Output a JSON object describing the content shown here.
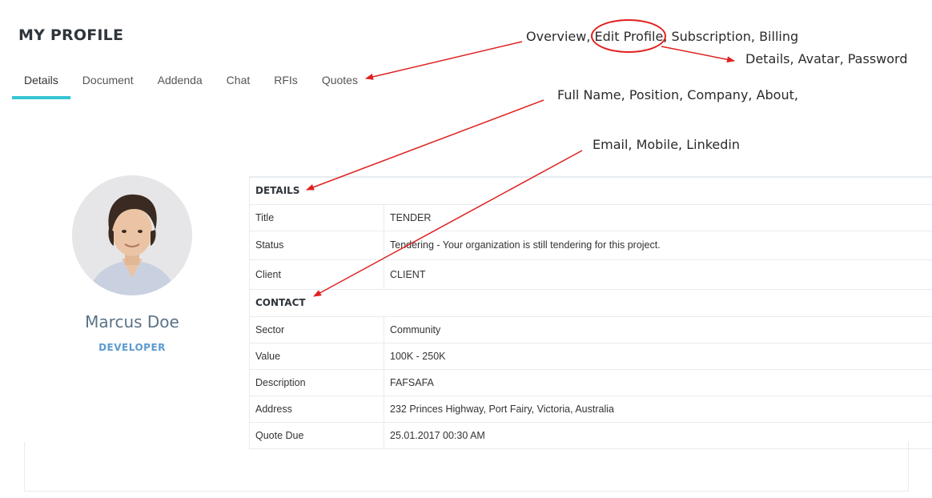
{
  "page": {
    "title": "MY PROFILE"
  },
  "tabs": [
    {
      "label": "Details",
      "active": true
    },
    {
      "label": "Document"
    },
    {
      "label": "Addenda"
    },
    {
      "label": "Chat"
    },
    {
      "label": "RFIs"
    },
    {
      "label": "Quotes"
    }
  ],
  "profile": {
    "name": "Marcus Doe",
    "role": "DEVELOPER",
    "avatar_icon": "avatar-photo"
  },
  "details": {
    "section_details": "DETAILS",
    "rows_a": [
      {
        "label": "Title",
        "value": "TENDER"
      },
      {
        "label": "Status",
        "value": "Tendering - Your organization is still tendering for this project."
      },
      {
        "label": "Client",
        "value": "CLIENT"
      }
    ],
    "section_contact": "CONTACT",
    "rows_b": [
      {
        "label": "Sector",
        "value": "Community"
      },
      {
        "label": "Value",
        "value": "100K - 250K"
      },
      {
        "label": "Description",
        "value": "FAFSAFA"
      },
      {
        "label": "Address",
        "value": "232 Princes Highway, Port Fairy, Victoria, Australia"
      },
      {
        "label": "Quote Due",
        "value": "25.01.2017 00:30 AM"
      }
    ]
  },
  "annotations": {
    "menu": "Overview, Edit Profile, Subscription, Billing",
    "edit_profile_sub": "Details, Avatar, Password",
    "fields_line1": "Full Name, Position, Company, About,",
    "fields_line2": "Email, Mobile, Linkedin",
    "arrow_color": "#e02020"
  },
  "colors": {
    "accent": "#36c6d3",
    "name": "#5b7288",
    "role": "#5b9bd1",
    "annotation": "#e02020"
  }
}
